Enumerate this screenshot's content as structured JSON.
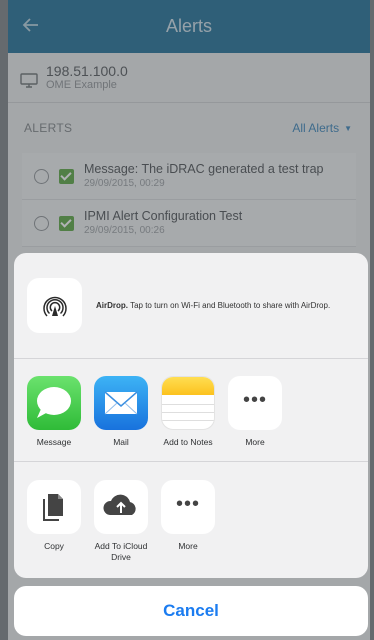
{
  "app": {
    "title": "Alerts",
    "device": {
      "ip": "198.51.100.0",
      "name": "OME Example"
    },
    "alerts_label": "ALERTS",
    "filter_label": "All Alerts",
    "alerts": [
      {
        "message": "Message: The iDRAC generated a test trap",
        "time": "29/09/2015, 00:29"
      },
      {
        "message": "IPMI Alert Configuration Test",
        "time": "29/09/2015, 00:26"
      }
    ]
  },
  "share": {
    "airdrop_title": "AirDrop.",
    "airdrop_text": "Tap to turn on Wi-Fi and Bluetooth to share with AirDrop.",
    "apps": [
      {
        "label": "Message",
        "icon": "message-icon"
      },
      {
        "label": "Mail",
        "icon": "mail-icon"
      },
      {
        "label": "Add to Notes",
        "icon": "notes-icon"
      },
      {
        "label": "More",
        "icon": "more-icon"
      }
    ],
    "actions": [
      {
        "label": "Copy",
        "icon": "copy-icon"
      },
      {
        "label": "Add To iCloud Drive",
        "icon": "icloud-drive-icon"
      },
      {
        "label": "More",
        "icon": "more-icon"
      }
    ],
    "cancel_label": "Cancel"
  },
  "colors": {
    "header": "#1f6f96",
    "accent": "#1b7cf0",
    "check": "#5aa540",
    "link": "#3a84b8"
  }
}
